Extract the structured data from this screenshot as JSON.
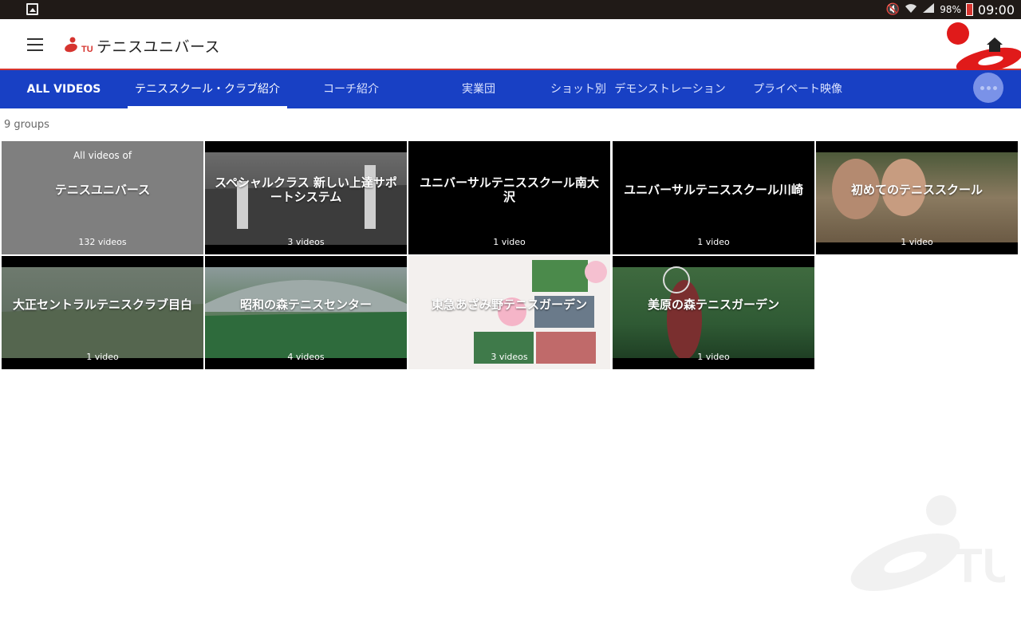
{
  "status_bar": {
    "battery_percent": "98%",
    "time": "09:00"
  },
  "app_bar": {
    "title": "テニスユニバース",
    "menu_icon": "hamburger-menu-icon",
    "home_icon": "home-icon"
  },
  "tabs": [
    {
      "label": "ALL VIDEOS",
      "active": false
    },
    {
      "label": "テニススクール・クラブ紹介",
      "active": true
    },
    {
      "label": "コーチ紹介",
      "active": false
    },
    {
      "label": "実業団",
      "active": false
    },
    {
      "label": "ショット別",
      "active": false
    },
    {
      "label": "デモンストレーション",
      "active": false
    },
    {
      "label": "プライベート映像",
      "active": false
    }
  ],
  "group_count": "9 groups",
  "groups": [
    {
      "pre": "All videos of",
      "title": "テニスユニバース",
      "count": "132 videos"
    },
    {
      "title": "スペシャルクラス 新しい上達サポートシステム",
      "count": "3 videos"
    },
    {
      "title": "ユニバーサルテニススクール南大沢",
      "count": "1 video"
    },
    {
      "title": "ユニバーサルテニススクール川崎",
      "count": "1 video"
    },
    {
      "title": "初めてのテニススクール",
      "count": "1 video"
    },
    {
      "title": "大正セントラルテニスクラブ目白",
      "count": "1 video"
    },
    {
      "title": "昭和の森テニスセンター",
      "count": "4 videos"
    },
    {
      "title": "東急あざみ野テニスガーデン",
      "count": "3 videos"
    },
    {
      "title": "美原の森テニスガーデン",
      "count": "1 video"
    }
  ],
  "colors": {
    "accent_blue": "#1840c4",
    "brand_red": "#d6342f"
  }
}
